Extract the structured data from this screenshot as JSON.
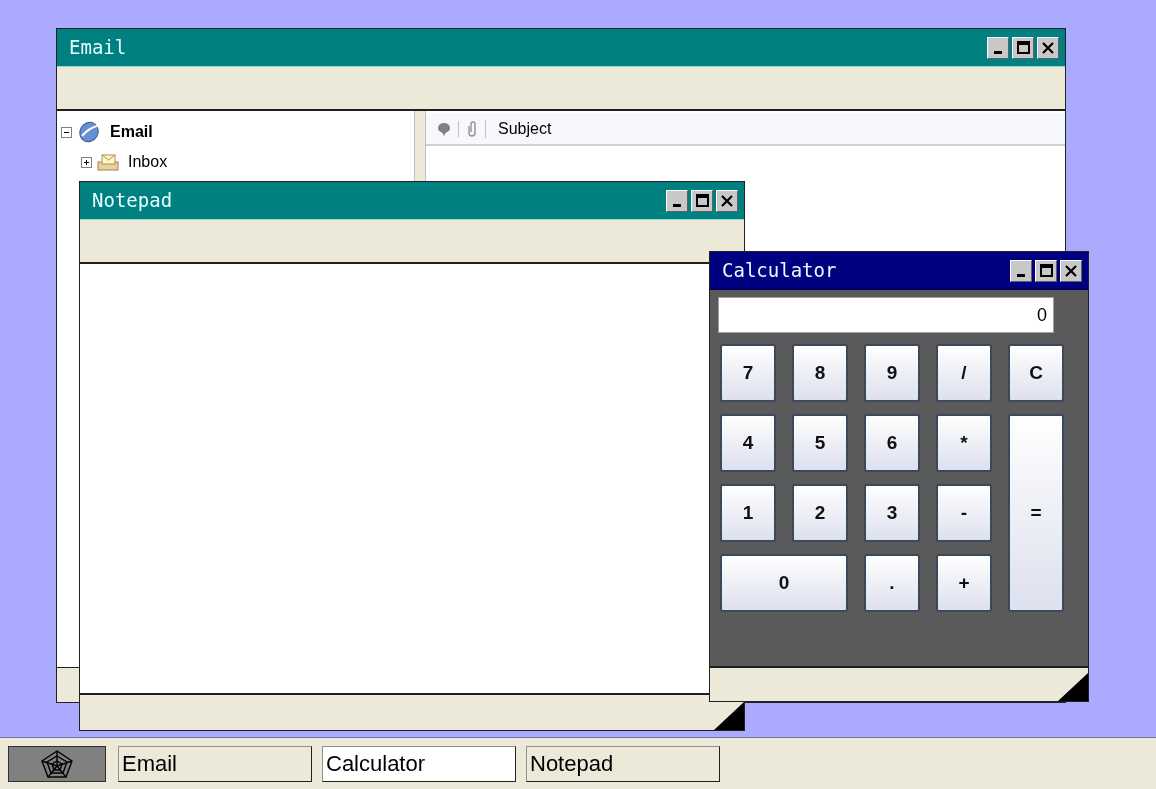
{
  "email_window": {
    "title": "Email",
    "active": false,
    "tree": [
      {
        "label": "Email",
        "expanded": true,
        "children": [
          {
            "label": "Inbox",
            "expanded": false
          }
        ]
      }
    ],
    "message_list": {
      "columns": [
        "Subject"
      ]
    }
  },
  "notepad_window": {
    "title": "Notepad",
    "active": false
  },
  "calculator_window": {
    "title": "Calculator",
    "active": true,
    "display": "0",
    "keys": [
      {
        "label": "7",
        "kind": "key"
      },
      {
        "label": "8",
        "kind": "key"
      },
      {
        "label": "9",
        "kind": "key"
      },
      {
        "label": "/",
        "kind": "key"
      },
      {
        "label": "C",
        "kind": "key"
      },
      {
        "label": "4",
        "kind": "key"
      },
      {
        "label": "5",
        "kind": "key"
      },
      {
        "label": "6",
        "kind": "key"
      },
      {
        "label": "*",
        "kind": "key"
      },
      {
        "label": "1",
        "kind": "key"
      },
      {
        "label": "2",
        "kind": "key"
      },
      {
        "label": "3",
        "kind": "key"
      },
      {
        "label": "-",
        "kind": "key"
      },
      {
        "label": "=",
        "kind": "tall_key"
      },
      {
        "label": "0",
        "kind": "wide_key"
      },
      {
        "label": ".",
        "kind": "key"
      },
      {
        "label": "+",
        "kind": "key"
      }
    ]
  },
  "taskbar": {
    "items": [
      {
        "label": "Email",
        "selected": false
      },
      {
        "label": "Calculator",
        "selected": true
      },
      {
        "label": "Notepad",
        "selected": false
      }
    ]
  }
}
